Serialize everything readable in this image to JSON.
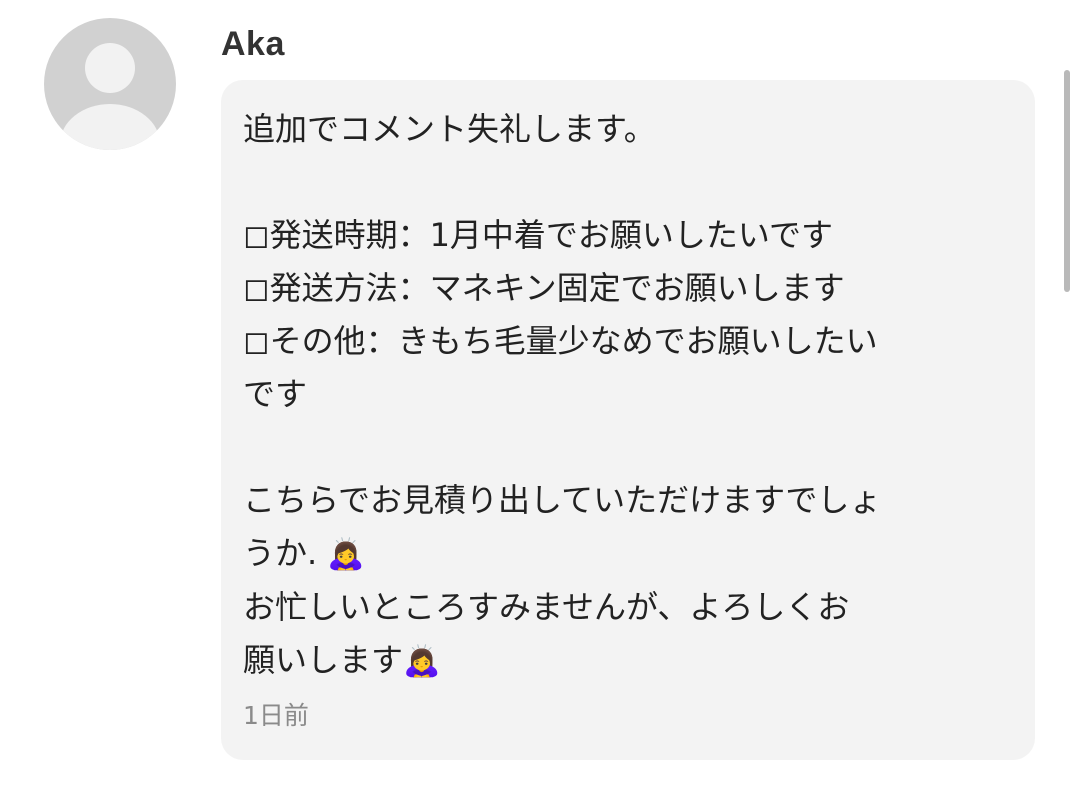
{
  "comment": {
    "author": "Aka",
    "lines": [
      "追加でコメント失礼します。",
      "",
      "◻︎発送時期：1月中着でお願いしたいです",
      "◻︎発送方法：マネキン固定でお願いします",
      "◻︎その他：きもち毛量少なめでお願いしたい",
      "です",
      "",
      "こちらでお見積り出していただけますでしょ",
      "うか.",
      "お忙しいところすみませんが、よろしくお",
      "願いします"
    ],
    "emoji": "🙇‍♀️",
    "timestamp": "1日前"
  },
  "icons": {
    "avatar": "default-user-avatar-icon",
    "bow": "person-bowing-emoji"
  },
  "colors": {
    "bubble_background": "#f3f3f3",
    "avatar_background": "#d1d1d1",
    "timestamp": "#8a8a8a"
  }
}
